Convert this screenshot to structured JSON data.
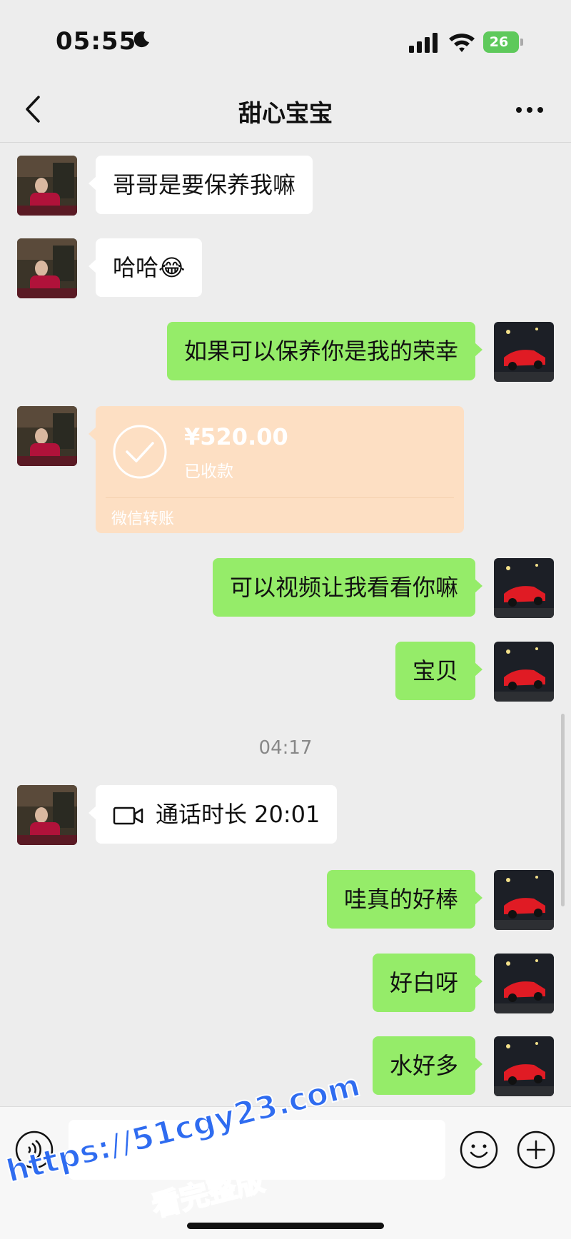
{
  "status_bar": {
    "time": "05:55",
    "battery": "26"
  },
  "header": {
    "title": "甜心宝宝"
  },
  "messages": [
    {
      "side": "in",
      "text": "哥哥是要保养我嘛"
    },
    {
      "side": "in",
      "text": "哈哈😂"
    },
    {
      "side": "out",
      "text": "如果可以保养你是我的荣幸"
    },
    {
      "side": "in",
      "type": "transfer"
    },
    {
      "side": "out",
      "text": "可以视频让我看看你嘛"
    },
    {
      "side": "out",
      "text": "宝贝"
    },
    {
      "side": "in",
      "type": "call"
    },
    {
      "side": "out",
      "text": "哇真的好棒"
    },
    {
      "side": "out",
      "text": "好白呀"
    },
    {
      "side": "out",
      "text": "水好多"
    }
  ],
  "transfer": {
    "amount": "¥520.00",
    "status": "已收款",
    "label": "微信转账"
  },
  "timestamp": "04:17",
  "call": {
    "text": "通话时长 20:01"
  },
  "watermark": {
    "url": "https://51cgy23.com",
    "sub": "看完整版"
  },
  "icons": {
    "back": "chevron-left-icon",
    "more": "more-dots-icon",
    "voice": "voice-icon",
    "emoji": "emoji-icon",
    "plus": "plus-icon",
    "video": "video-camera-icon",
    "transfer_received": "check-circle-icon"
  },
  "colors": {
    "out_bubble": "#95ec69",
    "in_bubble": "#ffffff",
    "transfer_bg": "#fddfc3",
    "background": "#ededed"
  }
}
